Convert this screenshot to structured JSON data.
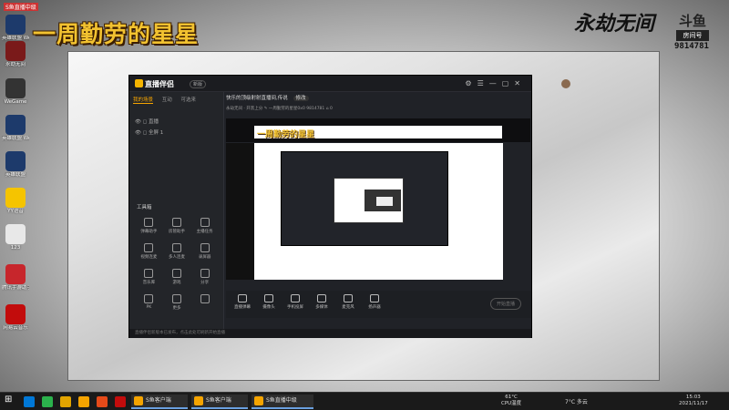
{
  "overlay": {
    "streamer_title": "一周勤劳的星星",
    "tag_small": "S鱼直播中级",
    "game_logo": "永劫无间",
    "platform_logo": "斗鱼",
    "room_label": "房间号",
    "room_id": "9814781"
  },
  "desktop_icons": [
    {
      "name": "英雄联盟 WeGame版",
      "label": "英雄联盟\nWeGame版",
      "icon": "lol-icon",
      "color": "#1d3a6b"
    },
    {
      "name": "永劫无间",
      "label": "永劫无间",
      "icon": "naraka-icon",
      "color": "#7a1a1a"
    },
    {
      "name": "WeGame",
      "label": "WeGame",
      "icon": "wegame-icon",
      "color": "#333"
    },
    {
      "name": "英雄联盟 WeGame版",
      "label": "英雄联盟\nWeGame版",
      "icon": "lol-icon",
      "color": "#1d3a6b"
    },
    {
      "name": "英雄联盟",
      "label": "英雄联盟",
      "icon": "lol-icon",
      "color": "#1d3a6b"
    },
    {
      "name": "YY语音",
      "label": "YY语音",
      "icon": "yy-icon",
      "color": "#f5c400"
    },
    {
      "name": "123",
      "label": "123",
      "icon": "file-icon",
      "color": "#e8e8e8"
    },
    {
      "name": "腾讯手游助手",
      "label": "腾讯手游助手",
      "icon": "tencent-icon",
      "color": "#c7262c"
    },
    {
      "name": "网易云音乐",
      "label": "网易云音乐",
      "icon": "netease-music-icon",
      "color": "#c20c0c"
    }
  ],
  "app": {
    "name": "直播伴侣",
    "version": "新版",
    "stream_title": "快乐的顶级射射直播间,传说",
    "stream_title_tag": "修改",
    "sub_info": "永劫无间 · 开黑上分 ✎   一周勤劳的星星0x0 9814781   ⌂ 0",
    "tabs": [
      "我的场景",
      "互动",
      "可选来"
    ],
    "scenes": [
      {
        "label": "直播"
      },
      {
        "label": "全屏 1"
      }
    ],
    "toolbox_title": "工具箱",
    "tools": [
      "弹幕助手",
      "房管助手",
      "主播任务",
      "视频连麦",
      "多人连麦",
      "录屏器",
      "音乐库",
      "游戏",
      "分享",
      "PK",
      "更多",
      ""
    ],
    "bottom_tools": [
      "直播弹幕",
      "摄像头",
      "手机投屏",
      "多媒体",
      "麦克风",
      "扬声器"
    ],
    "start_label": "开始直播",
    "status_text": "直播伴侣新版本已发布，点击此处可刷新开始直播"
  },
  "taskbar": {
    "tasks": [
      "S鱼客户端",
      "S鱼客户端",
      "S鱼直播中级"
    ],
    "weather": "61°C",
    "cpu_label": "CPU温度",
    "temp": "7°C 多云",
    "time": "15:03",
    "date": "2021/11/17"
  },
  "colors": {
    "accent": "#f5a400",
    "title": "#f2c230"
  }
}
